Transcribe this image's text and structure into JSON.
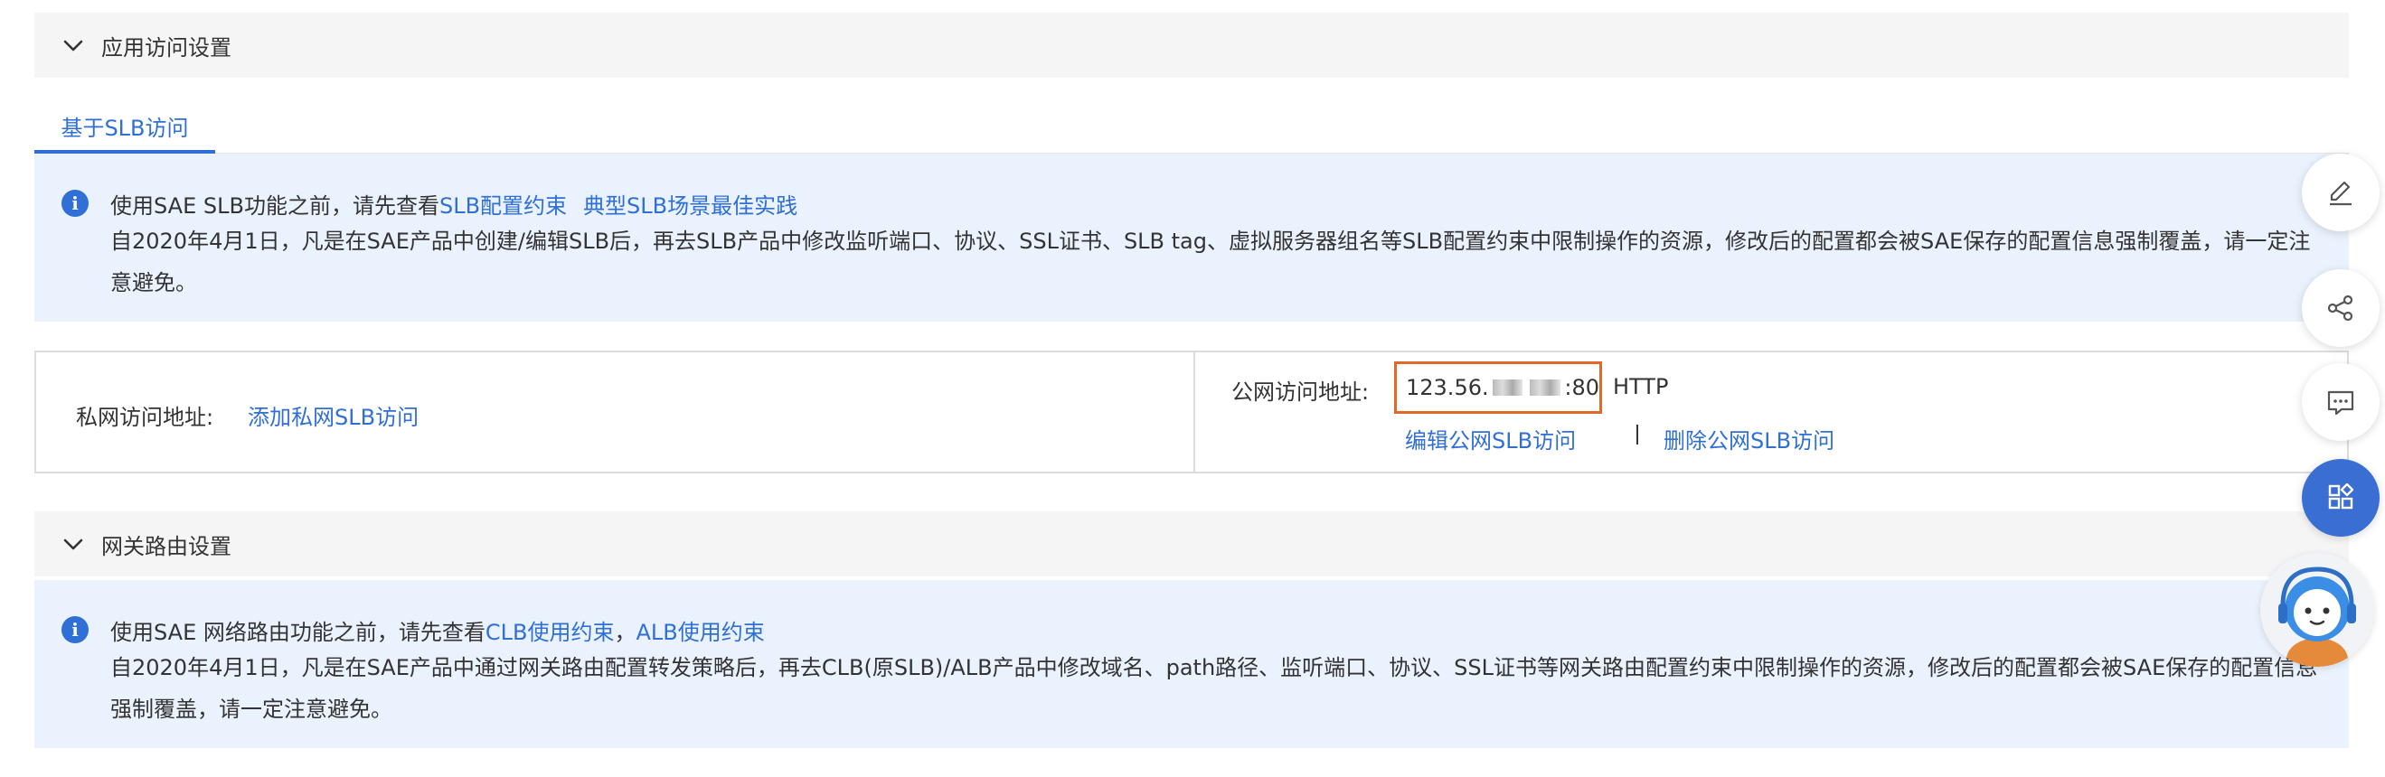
{
  "app_access": {
    "header_title": "应用访问设置",
    "tab_label": "基于SLB访问",
    "notice": {
      "prefix": "使用SAE SLB功能之前，请先查看",
      "link1": "SLB配置约束",
      "link2": "典型SLB场景最佳实践",
      "body": "自2020年4月1日，凡是在SAE产品中创建/编辑SLB后，再去SLB产品中修改监听端口、协议、SSL证书、SLB tag、虚拟服务器组名等SLB配置约束中限制操作的资源，修改后的配置都会被SAE保存的配置信息强制覆盖，请一定注意避免。"
    },
    "private": {
      "label": "私网访问地址:",
      "add_link": "添加私网SLB访问"
    },
    "public": {
      "label": "公网访问地址:",
      "ip_prefix": "123.56.",
      "ip_suffix": ":80",
      "protocol": "HTTP",
      "edit_link": "编辑公网SLB访问",
      "separator": "|",
      "delete_link": "删除公网SLB访问"
    }
  },
  "gateway_routing": {
    "header_title": "网关路由设置",
    "notice": {
      "prefix": "使用SAE 网络路由功能之前，请先查看",
      "link1": "CLB使用约束",
      "comma": "，",
      "link2": "ALB使用约束",
      "body": "自2020年4月1日，凡是在SAE产品中通过网关路由配置转发策略后，再去CLB(原SLB)/ALB产品中修改域名、path路径、监听端口、协议、SSL证书等网关路由配置约束中限制操作的资源，修改后的配置都会被SAE保存的配置信息强制覆盖，请一定注意避免。"
    }
  },
  "floating_toolbar": {
    "icons": [
      "edit-icon",
      "share-icon",
      "feedback-icon",
      "apps-icon"
    ],
    "assistant": "assistant-avatar-icon"
  },
  "colors": {
    "link": "#2f6fd6",
    "notice_bg": "#eaf2fd",
    "header_bg": "#f5f5f5",
    "highlight_border": "#e0692a"
  }
}
